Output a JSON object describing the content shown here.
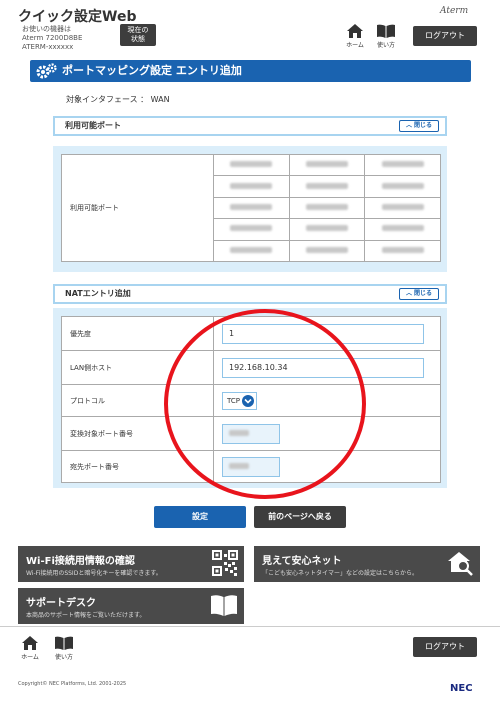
{
  "header": {
    "title": "クイック設定Web",
    "device_label": "お使いの機器は",
    "model": "Aterm 7200D8BE",
    "device_id": "ATERM-xxxxxx",
    "status_label_1": "現在の",
    "status_label_2": "状態",
    "brand": "Aterm",
    "home_label": "ホーム",
    "howto_label": "使い方",
    "logout_label": "ログアウト"
  },
  "page": {
    "title": "ポートマッピング設定 エントリ追加",
    "interface_text": "対象インタフェース ： WAN"
  },
  "available_ports": {
    "section_title": "利用可能ポート",
    "close_label": "閉じる",
    "row_label": "利用可能ポート",
    "rows": 5,
    "cols": 3
  },
  "nat_entry": {
    "section_title": "NATエントリ追加",
    "close_label": "閉じる",
    "fields": [
      {
        "label": "優先度",
        "value": "1"
      },
      {
        "label": "LAN側ホスト",
        "value": "192.168.10.34"
      },
      {
        "label": "プロトコル",
        "value": "TCP"
      },
      {
        "label": "変換対象ポート番号",
        "value": ""
      },
      {
        "label": "宛先ポート番号",
        "value": ""
      }
    ]
  },
  "actions": {
    "submit_label": "設定",
    "back_label": "前のページへ戻る"
  },
  "tiles": {
    "wifi_title": "Wi-Fi接続用情報の確認",
    "wifi_desc": "Wi-Fi接続用のSSIDと暗号化キーを確認できます。",
    "safety_title": "見えて安心ネット",
    "safety_desc": "「こども安心ネットタイマー」などの設定はこちらから。",
    "support_title": "サポートデスク",
    "support_desc": "本商品のサポート情報をご覧いただけます。"
  },
  "footer": {
    "home_label": "ホーム",
    "howto_label": "使い方",
    "logout_label": "ログアウト",
    "copyright": "Copyright© NEC Platforms, Ltd. 2001-2025",
    "nec": "NEC"
  },
  "colors": {
    "primary": "#1a63b0",
    "dark_button": "#3d3d3d",
    "panel_bg": "#dbeefa",
    "annotation_circle": "#e8141c"
  }
}
